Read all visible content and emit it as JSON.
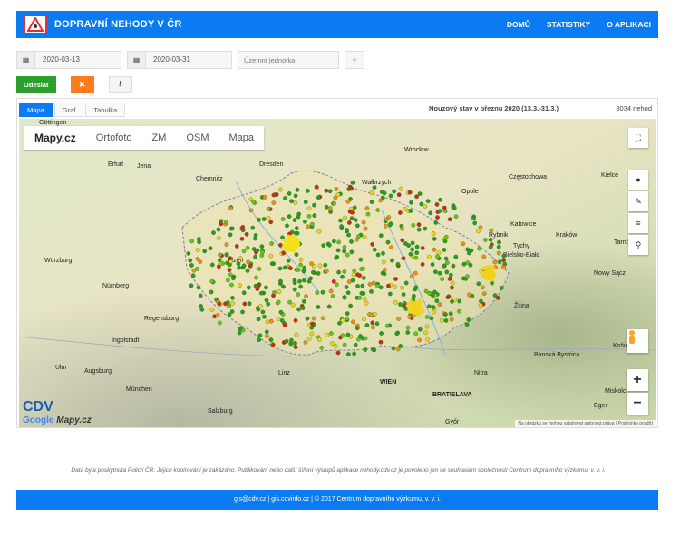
{
  "app": {
    "title": "DOPRAVNÍ NEHODY V ČR",
    "nav": [
      "DOMŮ",
      "STATISTIKY",
      "O APLIKACI"
    ],
    "brand_color": "#0b7bf3"
  },
  "filters": {
    "date_from": "2020-03-13",
    "date_to": "2020-03-31",
    "unit_placeholder": "Územní jednotka",
    "add_label": "+",
    "calendar_icon": "calendar-icon"
  },
  "actions": {
    "send_label": "Odeslat",
    "clear_icon": "close-icon",
    "download_icon": "download-icon"
  },
  "panel": {
    "tabs": [
      "Mapa",
      "Graf",
      "Tabulka"
    ],
    "active_tab": "Mapa",
    "title": "Nouzový stav v březnu 2020 (13.3.-31.3.)",
    "count": "3034 nehod"
  },
  "map": {
    "layers": [
      "Mapy.cz",
      "Ortofoto",
      "ZM",
      "OSM",
      "Mapa"
    ],
    "active_layer": "Mapy.cz",
    "attribution": "Na obrázku se mohou vztahovat autorská práva | Podmínky použití",
    "cities": [
      {
        "name": "Göttingen"
      },
      {
        "name": "Dresden"
      },
      {
        "name": "Wrocław"
      },
      {
        "name": "Erfurt"
      },
      {
        "name": "Jena"
      },
      {
        "name": "Chemnitz"
      },
      {
        "name": "Wałbrzych"
      },
      {
        "name": "Opole"
      },
      {
        "name": "Częstochowa"
      },
      {
        "name": "Kielce"
      },
      {
        "name": "Katowice"
      },
      {
        "name": "Rybnik"
      },
      {
        "name": "Kraków"
      },
      {
        "name": "Tychy"
      },
      {
        "name": "Bielsko-Biała"
      },
      {
        "name": "Würzburg"
      },
      {
        "name": "Plzeň"
      },
      {
        "name": "Nürnberg"
      },
      {
        "name": "Regensburg"
      },
      {
        "name": "Žilina"
      },
      {
        "name": "Nowy Sącz"
      },
      {
        "name": "Ingolstadt"
      },
      {
        "name": "Banská Bystrica"
      },
      {
        "name": "Košice"
      },
      {
        "name": "Ulm"
      },
      {
        "name": "Augsburg"
      },
      {
        "name": "München"
      },
      {
        "name": "Linz"
      },
      {
        "name": "Nitra"
      },
      {
        "name": "WIEN"
      },
      {
        "name": "BRATISLAVA"
      },
      {
        "name": "Salzburg"
      },
      {
        "name": "Miskolc"
      },
      {
        "name": "Győr"
      },
      {
        "name": "Eger"
      },
      {
        "name": "Tarnów"
      }
    ],
    "tools": [
      "fullscreen-icon",
      "globe-icon",
      "pencil-icon",
      "list-icon",
      "paperclip-icon"
    ],
    "zoom_in": "+",
    "zoom_out": "−",
    "logo_cdv": "CDV",
    "logo_google": "Google",
    "logo_mapy": "Mapy.cz"
  },
  "footer": {
    "note": "Data byla poskytnuta Policií ČR. Jejich kopírování je zakázáno. Publikování nebo další šíření výstupů aplikace nehody.cdv.cz je povoleno jen se souhlasem společnosti Centrum dopravního výzkumu, v. v. i.",
    "bar": "gis@cdv.cz | gis.cdvinfo.cz | © 2017 Centrum dopravního výzkumu, v. v. i."
  }
}
